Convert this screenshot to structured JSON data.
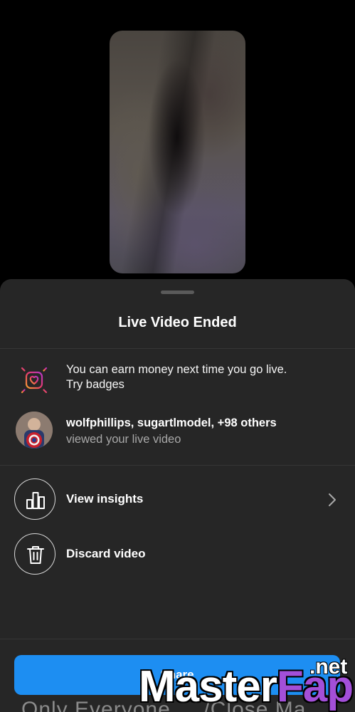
{
  "sheet": {
    "title": "Live Video Ended"
  },
  "badges_notice": {
    "line1": "You can earn money next time you go live.",
    "line2": "Try badges",
    "icon": "heart-badge-icon"
  },
  "viewers": {
    "names": "wolfphillips, sugartlmodel, +98 others",
    "subtitle": "viewed your live video"
  },
  "actions": [
    {
      "label": "View insights",
      "icon": "bar-chart-icon"
    },
    {
      "label": "Discard video",
      "icon": "trash-icon"
    }
  ],
  "share_button": {
    "label": "Share"
  },
  "footer_text": "Only Everyone ... /Close Ma",
  "watermark": {
    "main": "Master",
    "accent": "Fap",
    "suffix": ".net"
  },
  "colors": {
    "background": "#000000",
    "sheet": "#262626",
    "primary_button": "#1d8ef2",
    "secondary_text": "#a8a8a8",
    "watermark_accent": "#a34fd8"
  }
}
